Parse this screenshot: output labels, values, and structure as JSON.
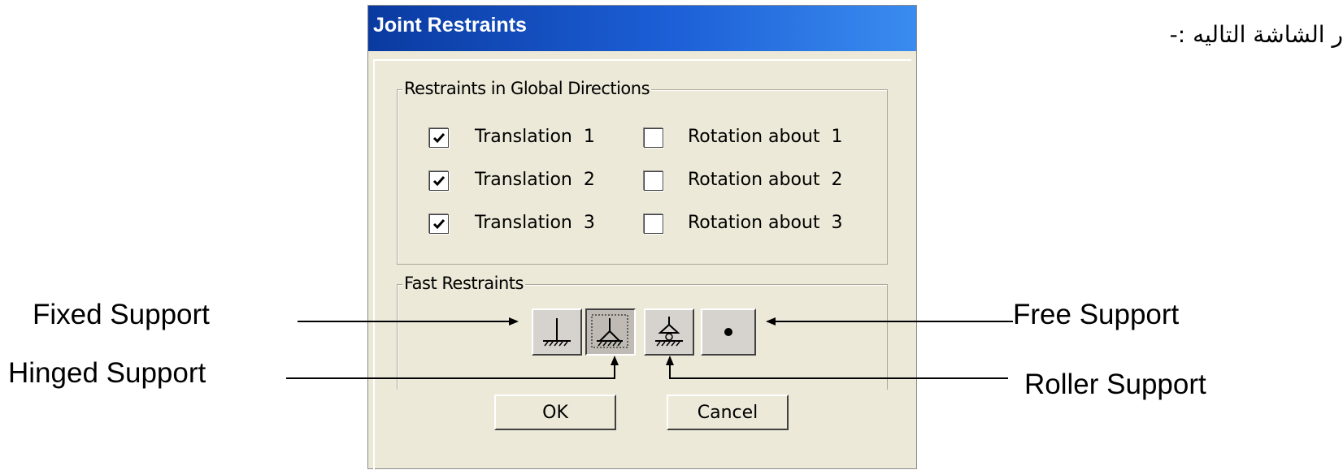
{
  "window": {
    "title": "Joint Restraints"
  },
  "page_text": {
    "arabic_caption": "ر الشاشة التاليه :-"
  },
  "global_restraints": {
    "title": "Restraints in Global Directions",
    "items": [
      {
        "label": "Translation  1",
        "checked": true
      },
      {
        "label": "Rotation about  1",
        "checked": false
      },
      {
        "label": "Translation  2",
        "checked": true
      },
      {
        "label": "Rotation about  2",
        "checked": false
      },
      {
        "label": "Translation  3",
        "checked": true
      },
      {
        "label": "Rotation about  3",
        "checked": false
      }
    ]
  },
  "fast_restraints": {
    "title": "Fast Restraints",
    "buttons": [
      {
        "name": "fixed",
        "icon": "fixed-support-icon",
        "pressed": false
      },
      {
        "name": "hinged",
        "icon": "hinged-support-icon",
        "pressed": true
      },
      {
        "name": "roller",
        "icon": "roller-support-icon",
        "pressed": false
      },
      {
        "name": "free",
        "icon": "free-support-icon",
        "pressed": false
      }
    ]
  },
  "buttons": {
    "ok": "OK",
    "cancel": "Cancel"
  },
  "annotations": {
    "fixed": "Fixed Support",
    "hinged": "Hinged Support",
    "free": "Free Support",
    "roller": "Roller Support"
  },
  "colors": {
    "titlebar_start": "#0a3aa0",
    "titlebar_end": "#3a8cf0",
    "dialog_face": "#ece9d8"
  }
}
